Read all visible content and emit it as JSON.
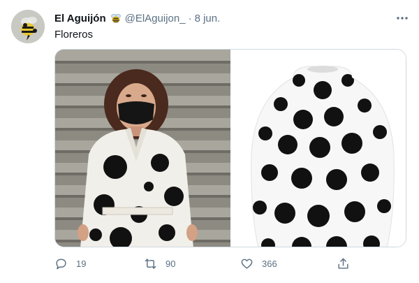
{
  "tweet": {
    "author_name": "El Aguijón",
    "handle": "@ElAguijon_",
    "separator": "·",
    "date": "8 jun.",
    "text": "Floreros",
    "images": [
      {
        "icon": "photo-woman-polka-dot-coat"
      },
      {
        "icon": "photo-polka-dot-vase"
      }
    ],
    "actions": {
      "replies": "19",
      "retweets": "90",
      "likes": "366"
    },
    "colors": {
      "secondary_text": "#5b7083",
      "primary_text": "#0f1419",
      "border": "#cfd9de"
    }
  }
}
